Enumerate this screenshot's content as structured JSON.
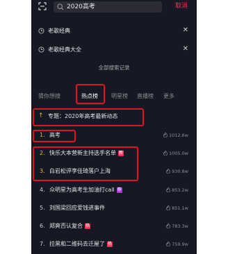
{
  "search": {
    "query": "2020高考",
    "cancel_label": "取消"
  },
  "history": [
    {
      "text": "老歌经典"
    },
    {
      "text": "老歌经典大全"
    }
  ],
  "all_history_label": "全部搜索记录",
  "tabs": [
    {
      "label": "猜你想搜"
    },
    {
      "label": "热点榜"
    },
    {
      "label": "明星榜"
    },
    {
      "label": "直播榜"
    },
    {
      "label": "更多"
    }
  ],
  "topic": {
    "icon": "pin-top-arrow-icon",
    "text": "专题：2020年高考最新动态"
  },
  "list": [
    {
      "rank": "1.",
      "title": "高考",
      "heat": "1012.6w"
    },
    {
      "rank": "2.",
      "title": "快乐大本营新主持选手名单",
      "badge": "新",
      "heat": "1005.0w"
    },
    {
      "rank": "3.",
      "title": "白岩松评李佳琦落户上海",
      "heat": "930.8w"
    },
    {
      "rank": "4.",
      "title": "众明星为高考生加油打call",
      "badge": "荐",
      "heat": "853.2w"
    },
    {
      "rank": "5.",
      "title": "刘国梁回应爱钱进事件",
      "heat": "851.1w"
    },
    {
      "rank": "6.",
      "title": "郑爽否认复合",
      "badge": "热",
      "heat": "783.3w"
    },
    {
      "rank": "7.",
      "title": "拉黑和二维码去迁屋了",
      "badge": "热",
      "heat": "759.9w"
    }
  ],
  "colors": {
    "accent": "#fe2c55",
    "background": "#161823",
    "annotation": "#e0141e",
    "gold": "#f6b73c"
  }
}
